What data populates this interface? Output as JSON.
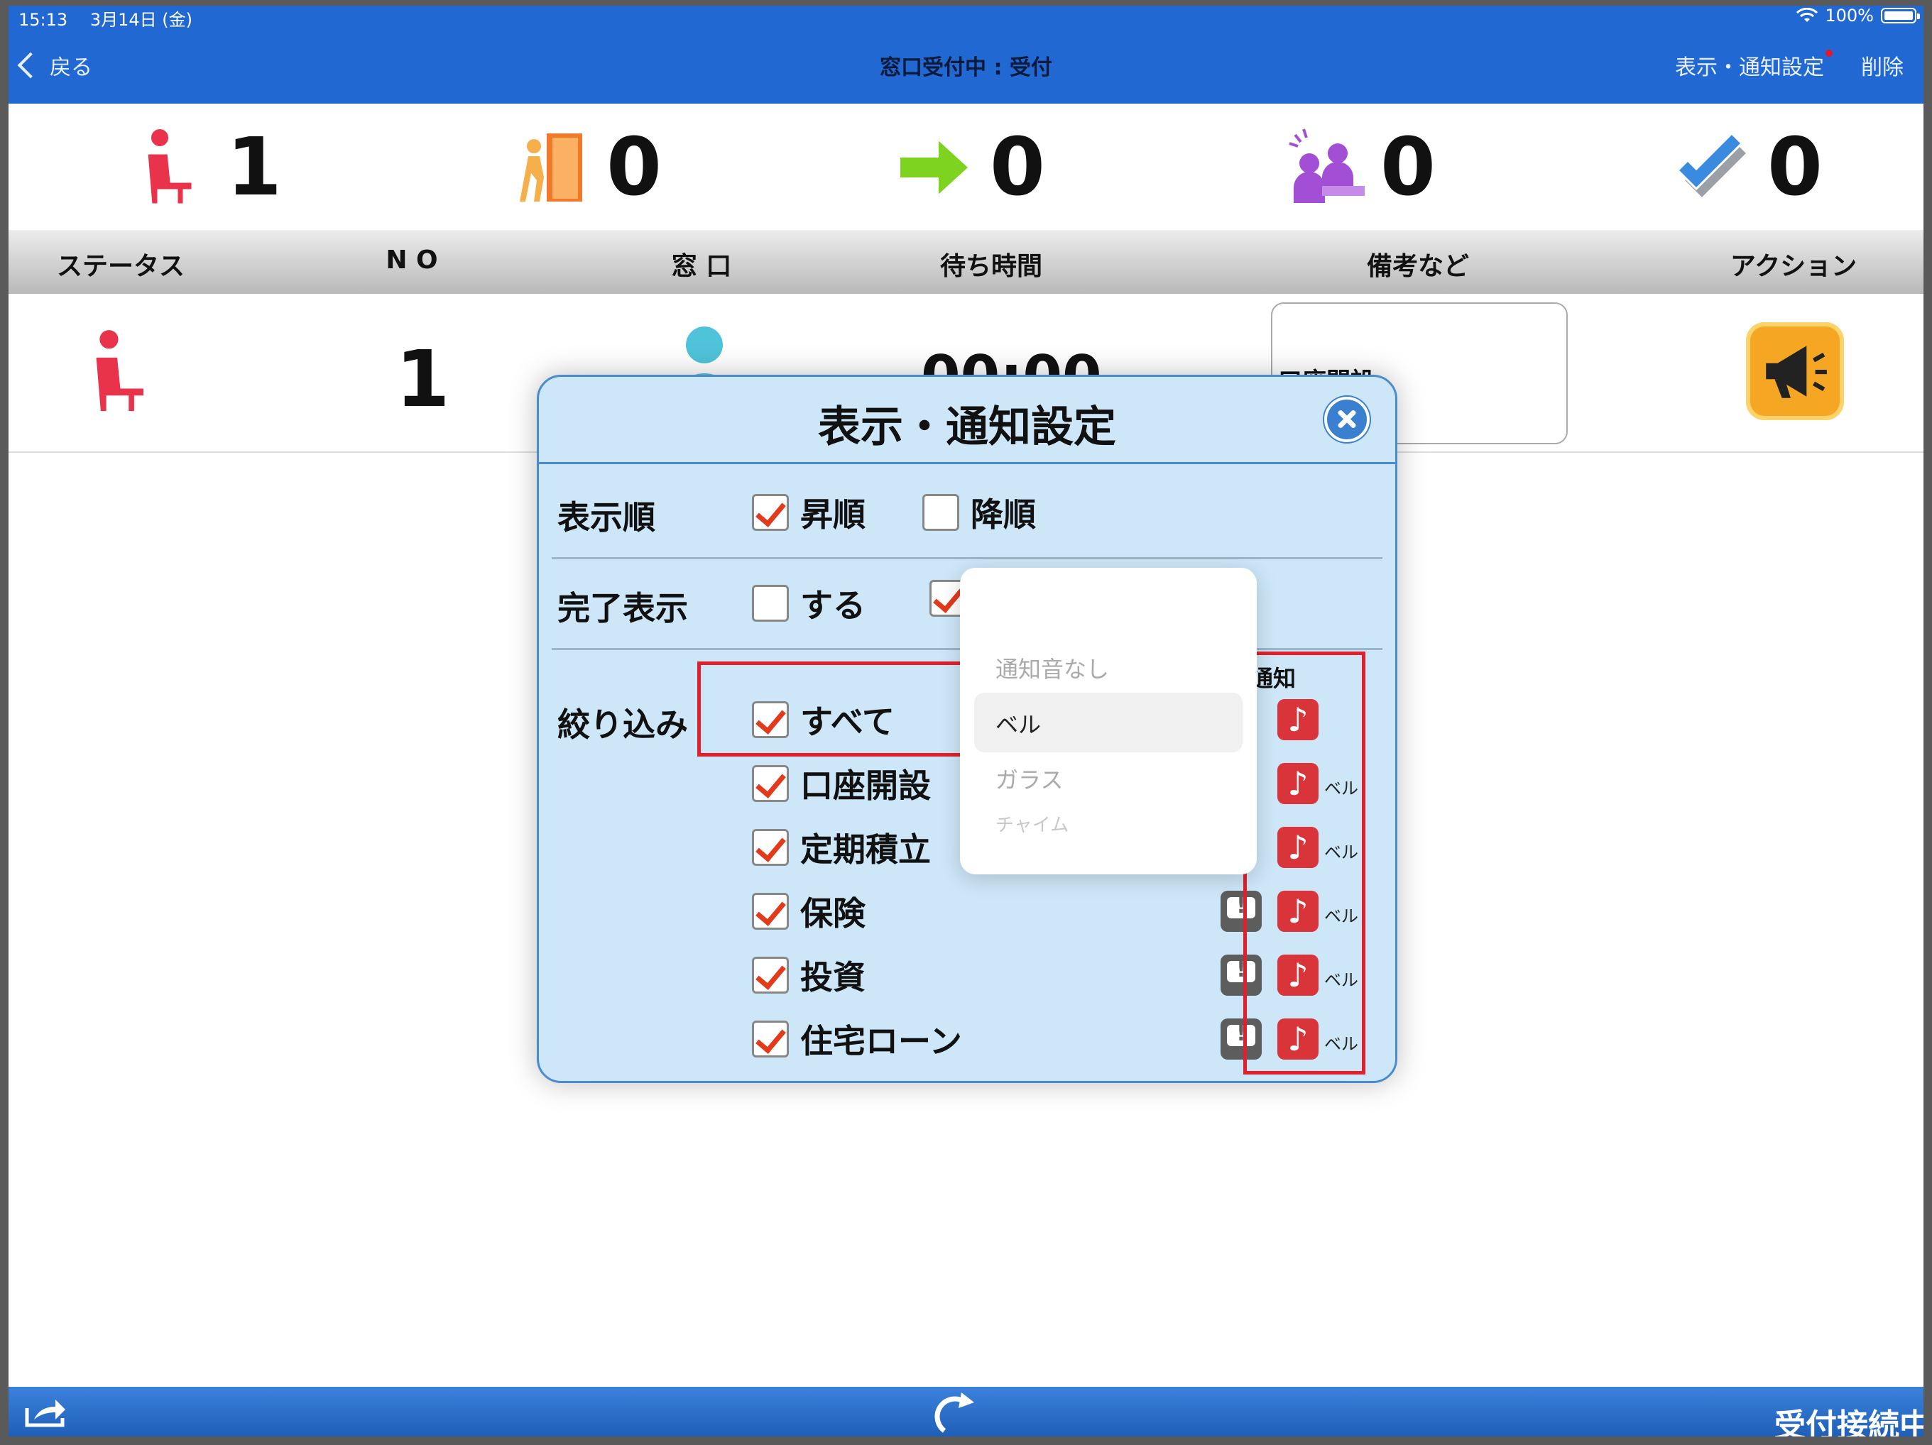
{
  "status_bar": {
    "time": "15:13",
    "date": "3月14日 (金)",
    "battery": "100%"
  },
  "nav": {
    "back_label": "戻る",
    "title": "窓口受付中 : 受付",
    "settings_label": "表示・通知設定",
    "delete_label": "削除"
  },
  "counters": [
    {
      "icon": "waiting-person-icon",
      "value": "1"
    },
    {
      "icon": "door-exit-icon",
      "value": "0"
    },
    {
      "icon": "green-arrow-icon",
      "value": "0"
    },
    {
      "icon": "meeting-people-icon",
      "value": "0"
    },
    {
      "icon": "check-mark-icon",
      "value": "0"
    }
  ],
  "table": {
    "headers": [
      "ステータス",
      "N O",
      "窓 口",
      "待ち時間",
      "備考など",
      "アクション"
    ],
    "rows": [
      {
        "no": "1",
        "wait": "00:00",
        "remark": "口座開設"
      }
    ]
  },
  "modal": {
    "title": "表示・通知設定",
    "sort": {
      "label": "表示順",
      "asc": "昇順",
      "desc": "降順",
      "asc_checked": true,
      "desc_checked": false
    },
    "done": {
      "label": "完了表示",
      "show": "する",
      "show_checked": false,
      "hide_checked": true
    },
    "filter": {
      "label": "絞り込み",
      "notify_header": "通知",
      "items": [
        {
          "label": "すべて",
          "checked": true,
          "sound": ""
        },
        {
          "label": "口座開設",
          "checked": true,
          "sound": "ベル"
        },
        {
          "label": "定期積立",
          "checked": true,
          "sound": "ベル"
        },
        {
          "label": "保険",
          "checked": true,
          "sound": "ベル"
        },
        {
          "label": "投資",
          "checked": true,
          "sound": "ベル"
        },
        {
          "label": "住宅ローン",
          "checked": true,
          "sound": "ベル"
        }
      ]
    }
  },
  "sound_picker": {
    "options": [
      "通知音なし",
      "ベル",
      "ガラス",
      "チャイム"
    ],
    "selected": "ベル"
  },
  "bottom_bar": {
    "connection_status": "受付接続中"
  },
  "colors": {
    "nav_blue": "#2268d2",
    "modal_bg": "#cde7f8",
    "highlight_red": "#e1202e",
    "check_red": "#e23a1a"
  }
}
